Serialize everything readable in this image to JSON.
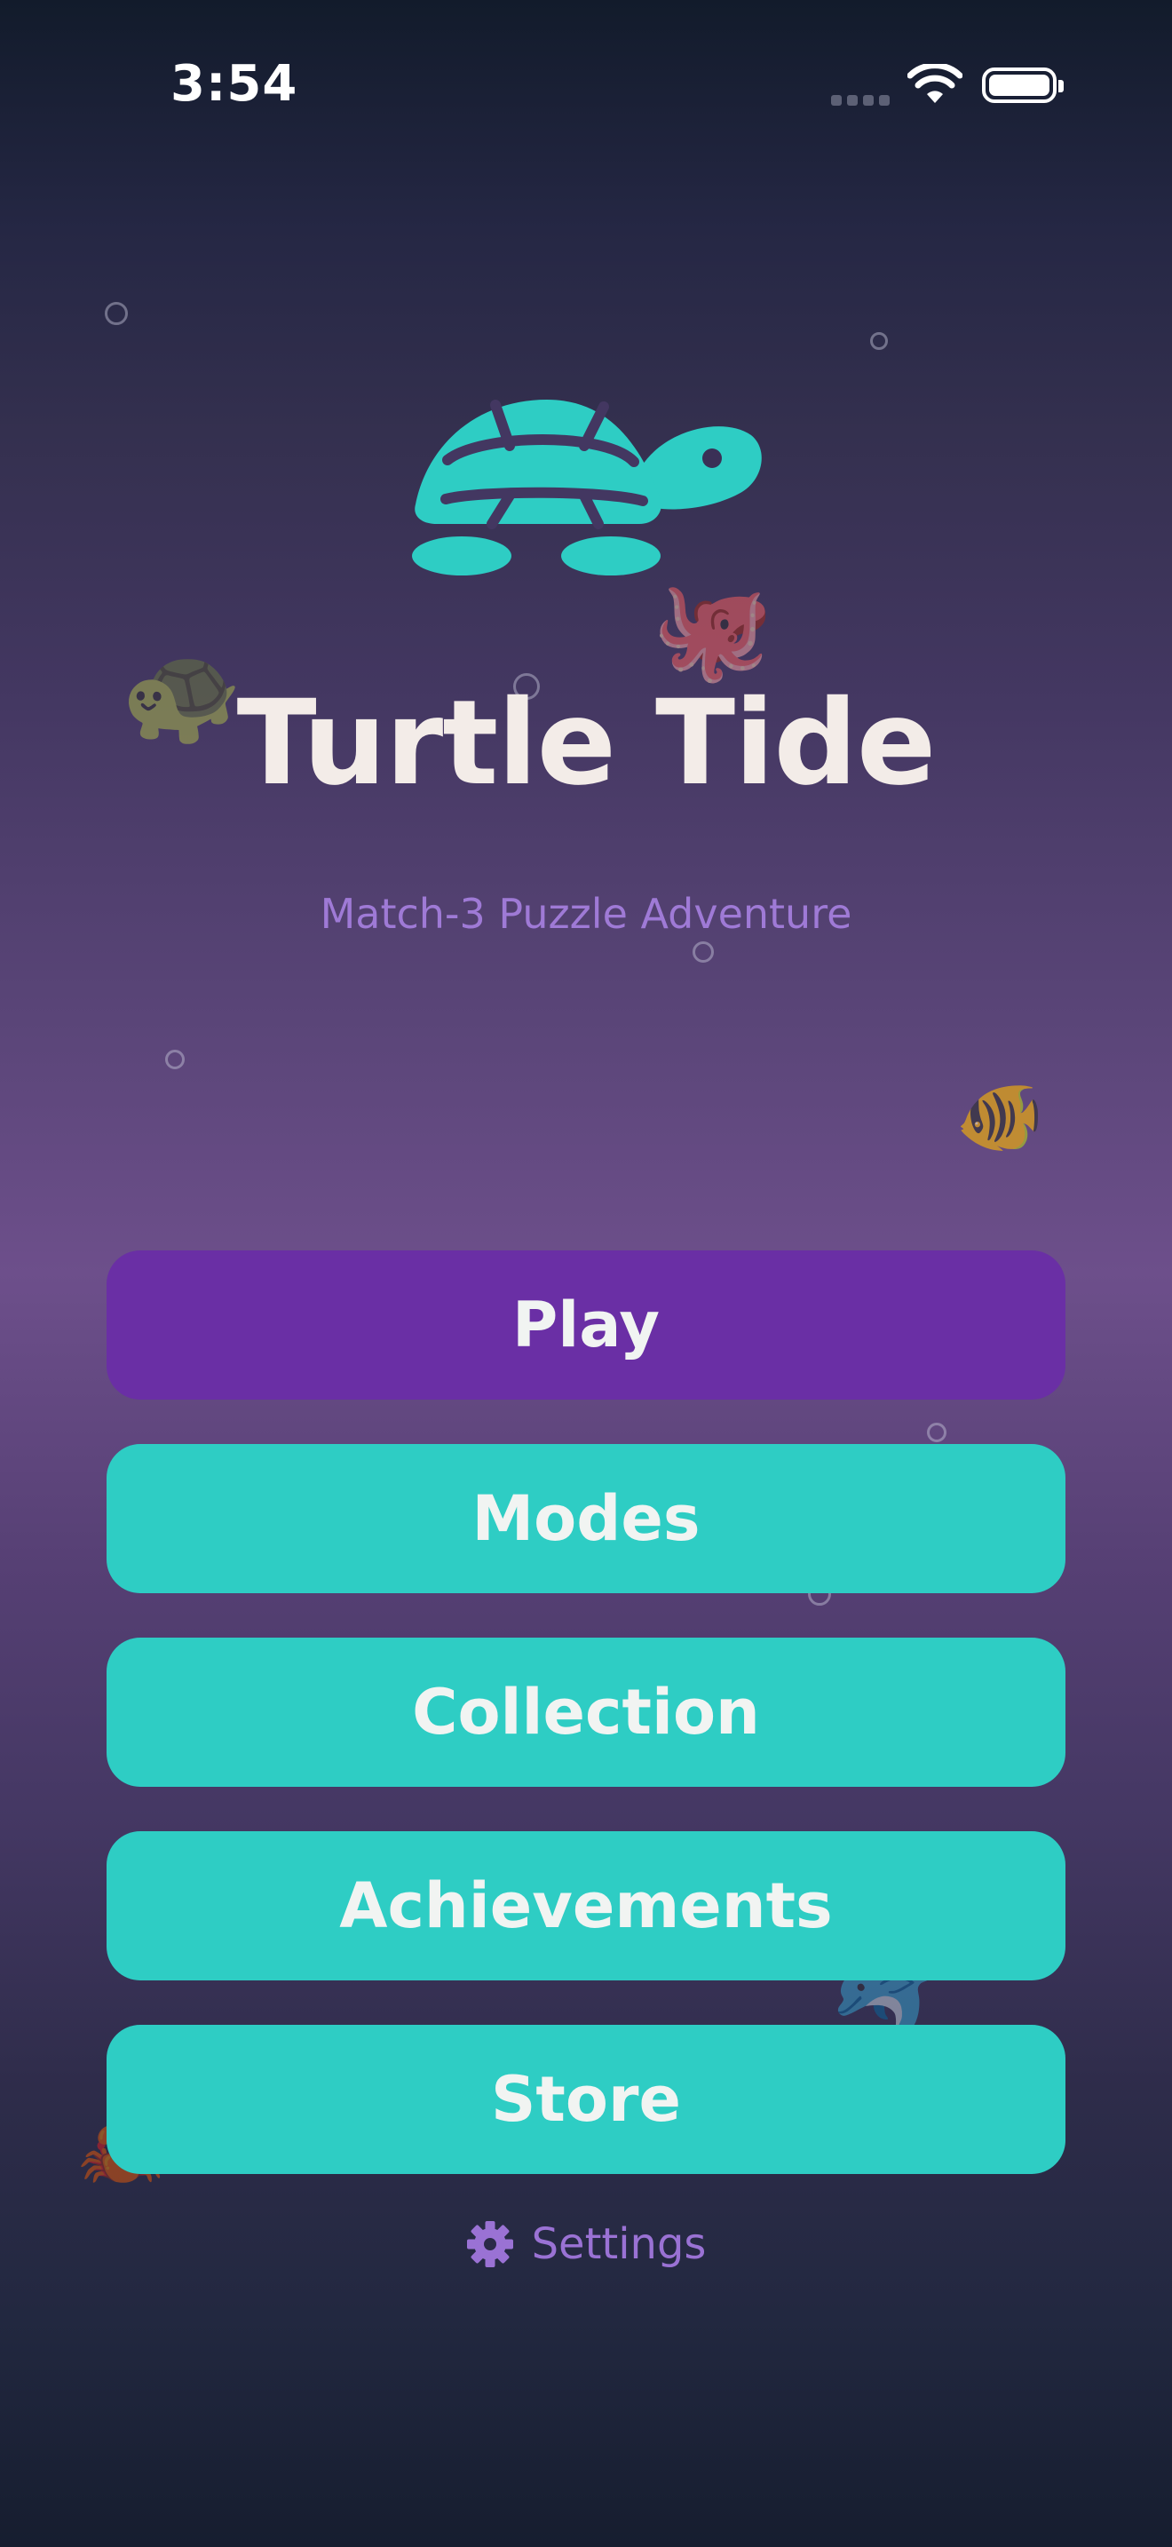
{
  "status_bar": {
    "time": "3:54"
  },
  "app": {
    "title": "Turtle Tide",
    "subtitle": "Match-3 Puzzle Adventure",
    "logo_icon": "turtle-icon",
    "accent_teal": "#2ecdc4",
    "accent_purple": "#6a2fa5"
  },
  "decorations": {
    "emojis": [
      "🐢",
      "🐙",
      "🐠",
      "🐬",
      "🦀"
    ]
  },
  "menu": {
    "play": "Play",
    "modes": "Modes",
    "collection": "Collection",
    "achievements": "Achievements",
    "store": "Store"
  },
  "settings": {
    "label": "Settings",
    "icon": "gear-icon"
  }
}
